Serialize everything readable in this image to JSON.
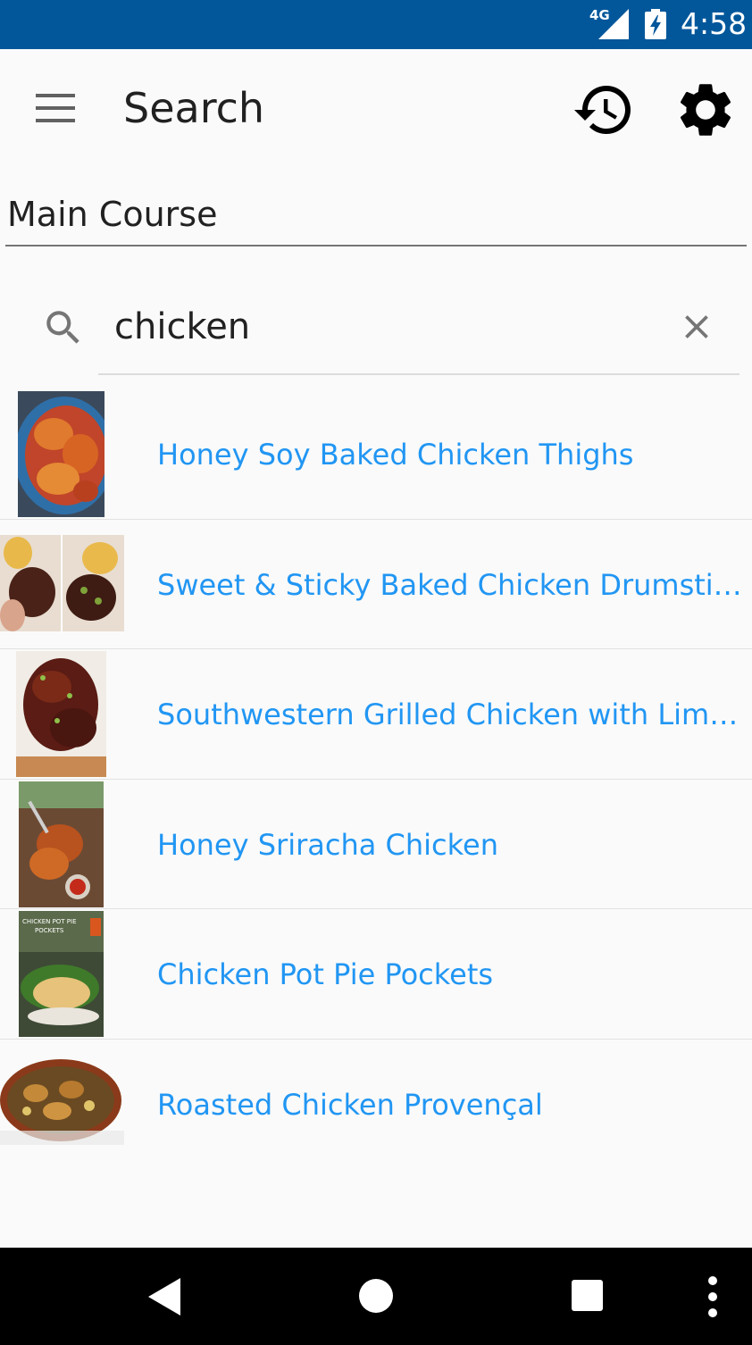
{
  "status_bar": {
    "network": "4G",
    "time": "4:58",
    "icons": [
      "signal-icon",
      "battery-charging-icon"
    ]
  },
  "toolbar": {
    "title": "Search",
    "icons": [
      "menu-icon",
      "history-icon",
      "settings-icon"
    ]
  },
  "category": {
    "label": "Main Course"
  },
  "search": {
    "value": "chicken",
    "icons": [
      "search-icon",
      "clear-icon"
    ]
  },
  "results": [
    {
      "title": "Honey Soy Baked Chicken Thighs"
    },
    {
      "title": "Sweet & Sticky Baked Chicken Drumsticks"
    },
    {
      "title": "Southwestern Grilled Chicken with Lime Butter"
    },
    {
      "title": "Honey Sriracha Chicken"
    },
    {
      "title": "Chicken Pot Pie Pockets",
      "thumb_text": "CHICKEN POT PIE POCKETS"
    },
    {
      "title": "Roasted Chicken Provençal"
    }
  ],
  "nav_bar": {
    "icons": [
      "back-icon",
      "home-icon",
      "recents-icon",
      "more-icon"
    ]
  },
  "colors": {
    "status_bar": "#02579b",
    "link_text": "#2196f3",
    "background": "#fafafa",
    "nav_bar": "#000000"
  }
}
